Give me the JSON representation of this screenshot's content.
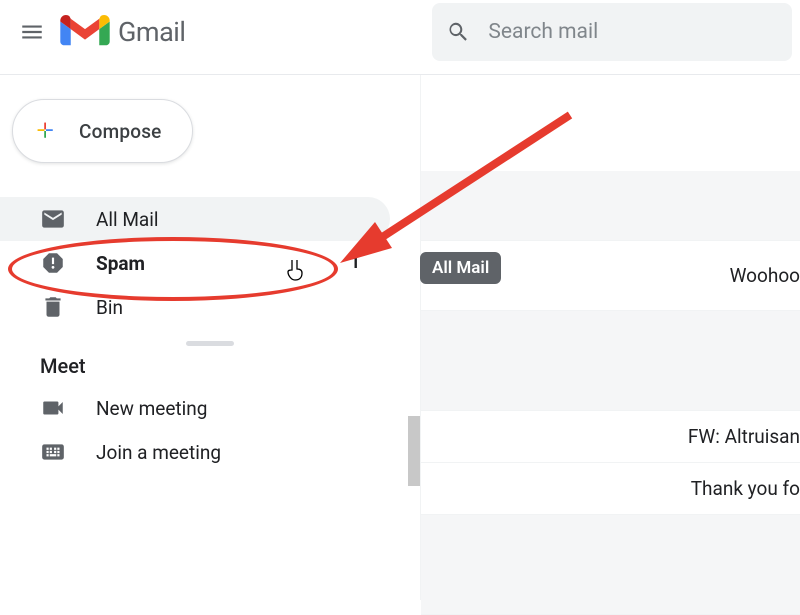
{
  "header": {
    "app_name": "Gmail",
    "search_placeholder": "Search mail"
  },
  "compose_label": "Compose",
  "sidebar": {
    "items": [
      {
        "label": "All Mail",
        "count": ""
      },
      {
        "label": "Spam",
        "count": "1"
      },
      {
        "label": "Bin",
        "count": ""
      }
    ]
  },
  "meet": {
    "header": "Meet",
    "items": [
      {
        "label": "New meeting"
      },
      {
        "label": "Join a meeting"
      }
    ]
  },
  "tooltip": "All Mail",
  "mail_previews": {
    "row1": "Woohoo",
    "row2": "FW: Altruisan",
    "row3": "Thank you fo"
  }
}
